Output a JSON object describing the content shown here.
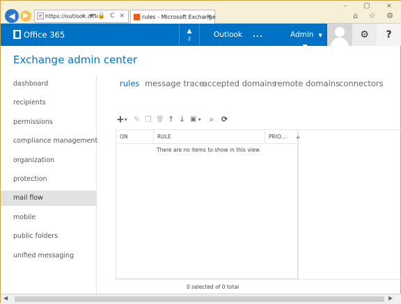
{
  "browser": {
    "back_icon": "back-arrow",
    "forward_icon": "forward-arrow",
    "url": "https://outlook.office3...",
    "address_icons": "⌕ ▾ 🔒 C ×",
    "tab_title": "rules - Microsoft Exchange",
    "tab_close": "×",
    "window_buttons": "– ▢ ×",
    "toolbar_icons": "⌂ ☆ ⚙"
  },
  "o365": {
    "brand": "Office 365",
    "notification_count": "2",
    "outlook": "Outlook",
    "more": "...",
    "admin": "Admin",
    "settings_icon": "⚙",
    "help_icon": "?"
  },
  "page": {
    "title": "Exchange admin center"
  },
  "sidebar": {
    "items": [
      {
        "label": "dashboard"
      },
      {
        "label": "recipients"
      },
      {
        "label": "permissions"
      },
      {
        "label": "compliance management"
      },
      {
        "label": "organization"
      },
      {
        "label": "protection"
      },
      {
        "label": "mail flow",
        "selected": true
      },
      {
        "label": "mobile"
      },
      {
        "label": "public folders"
      },
      {
        "label": "unified messaging"
      }
    ]
  },
  "tabs": [
    {
      "label": "rules",
      "selected": true
    },
    {
      "label": "message trace"
    },
    {
      "label": "accepted domains"
    },
    {
      "label": "remote domains"
    },
    {
      "label": "connectors"
    }
  ],
  "toolbar": {
    "add": "+",
    "dropdown": "▾",
    "edit": "✎",
    "copy": "❐",
    "delete": "🗑",
    "move_up": "↑",
    "move_down": "↓",
    "export": "▣",
    "search": "⌕",
    "refresh": "⟳"
  },
  "grid": {
    "columns": [
      "ON",
      "RULE",
      "PRIO..."
    ],
    "sort_indicator": "▲",
    "empty_message": "There are no items to show in this view.",
    "status": "0 selected of 0 total"
  },
  "colors": {
    "brand_blue": "#0072c6",
    "selected_nav": "#e2e2e2"
  }
}
